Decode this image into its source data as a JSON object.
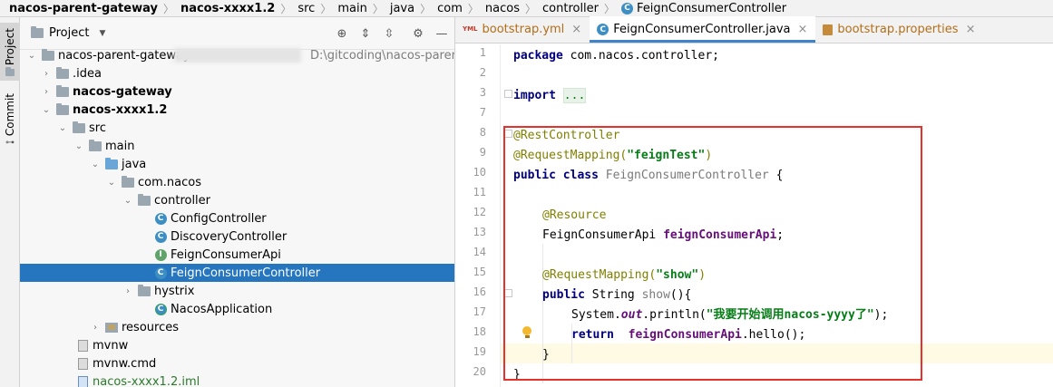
{
  "breadcrumb": {
    "items": [
      "nacos-parent-gateway",
      "nacos-xxxx1.2",
      "src",
      "main",
      "java",
      "com",
      "nacos",
      "controller"
    ],
    "current": "FeignConsumerController"
  },
  "stripe": {
    "project_label": "Project",
    "commit_label": "Commit"
  },
  "project_panel": {
    "title": "Project",
    "tree": [
      {
        "label": "nacos-parent-gateway",
        "path": "D:\\gitcoding\\nacos-parent-"
      },
      {
        "label": ".idea"
      },
      {
        "label": "nacos-gateway"
      },
      {
        "label": "nacos-xxxx1.2"
      },
      {
        "label": "src"
      },
      {
        "label": "main"
      },
      {
        "label": "java"
      },
      {
        "label": "com.nacos"
      },
      {
        "label": "controller"
      },
      {
        "label": "ConfigController",
        "icon": "class-icon"
      },
      {
        "label": "DiscoveryController",
        "icon": "class-icon"
      },
      {
        "label": "FeignConsumerApi",
        "icon": "interface-icon"
      },
      {
        "label": "FeignConsumerController",
        "icon": "class-icon",
        "selected": true
      },
      {
        "label": "hystrix"
      },
      {
        "label": "NacosApplication",
        "icon": "spring-app-icon"
      },
      {
        "label": "resources"
      },
      {
        "label": "mvnw"
      },
      {
        "label": "mvnw.cmd"
      },
      {
        "label": "nacos-xxxx1.2.iml"
      }
    ]
  },
  "tabs": [
    {
      "label": "bootstrap.yml",
      "icon_text": "YML"
    },
    {
      "label": "FeignConsumerController.java",
      "icon_text": "C"
    },
    {
      "label": "bootstrap.properties"
    }
  ],
  "editor": {
    "line_numbers": [
      "1",
      "2",
      "3",
      "7",
      "8",
      "9",
      "10",
      "11",
      "12",
      "13",
      "14",
      "15",
      "16",
      "17",
      "18",
      "19",
      "20"
    ],
    "code": {
      "l1_kw": "package",
      "l1_rest": " com.nacos.controller;",
      "l3_kw": "import",
      "l3_fold": "...",
      "l8": "@RestController",
      "l9_ann": "@RequestMapping(",
      "l9_str": "\"feignTest\"",
      "l9_end": ")",
      "l10_kw": "public class",
      "l10_name": " FeignConsumerController",
      "l10_end": " {",
      "l12": "@Resource",
      "l13_type": "FeignConsumerApi ",
      "l13_field": "feignConsumerApi",
      "l13_end": ";",
      "l15_ann": "@RequestMapping(",
      "l15_str": "\"show\"",
      "l15_end": ")",
      "l16_kw": "public",
      "l16_type": " String ",
      "l16_name": "show",
      "l16_end": "(){",
      "l17_a": "System.",
      "l17_out": "out",
      "l17_b": ".println(",
      "l17_str": "\"我要开始调用nacos-yyyy了\"",
      "l17_end": ");",
      "l18_kw": "return",
      "l18_field": "  feignConsumerApi",
      "l18_end": ".hello();",
      "l19": "}",
      "l20": "}"
    }
  },
  "colors": {
    "highlight_box": "#e8312c",
    "selection": "#2675bf"
  }
}
